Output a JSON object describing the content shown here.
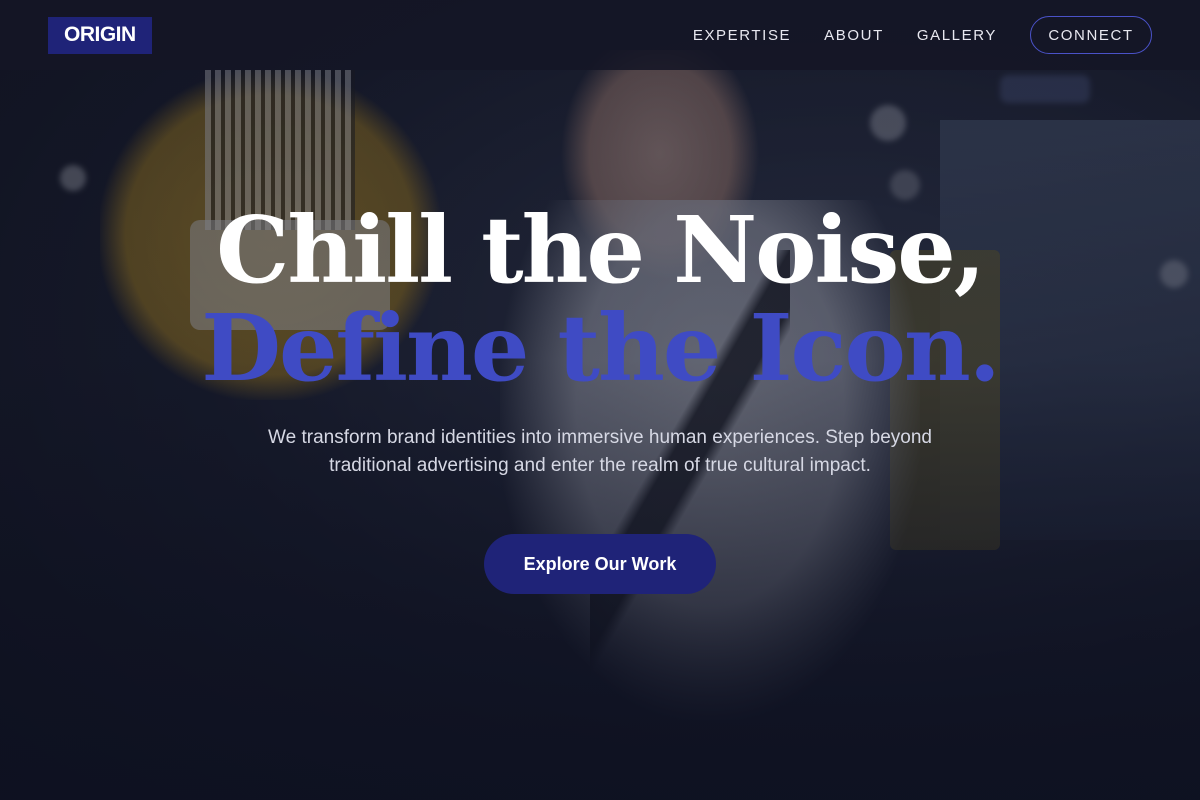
{
  "nav": {
    "logo": "ORIGIN",
    "links": [
      "EXPERTISE",
      "ABOUT",
      "GALLERY"
    ],
    "connect_label": "CONNECT"
  },
  "hero": {
    "headline_line1": "Chill the Noise,",
    "headline_line2": "Define the Icon.",
    "subtext": "We transform brand identities into immersive human experiences. Step beyond traditional advertising and enter the realm of true cultural impact.",
    "cta_label": "Explore Our Work"
  },
  "colors": {
    "brand_navy": "#1f2378",
    "accent_blue": "#3f4bc4",
    "overlay": "#0e1121",
    "text_light": "#d6d8e4"
  }
}
